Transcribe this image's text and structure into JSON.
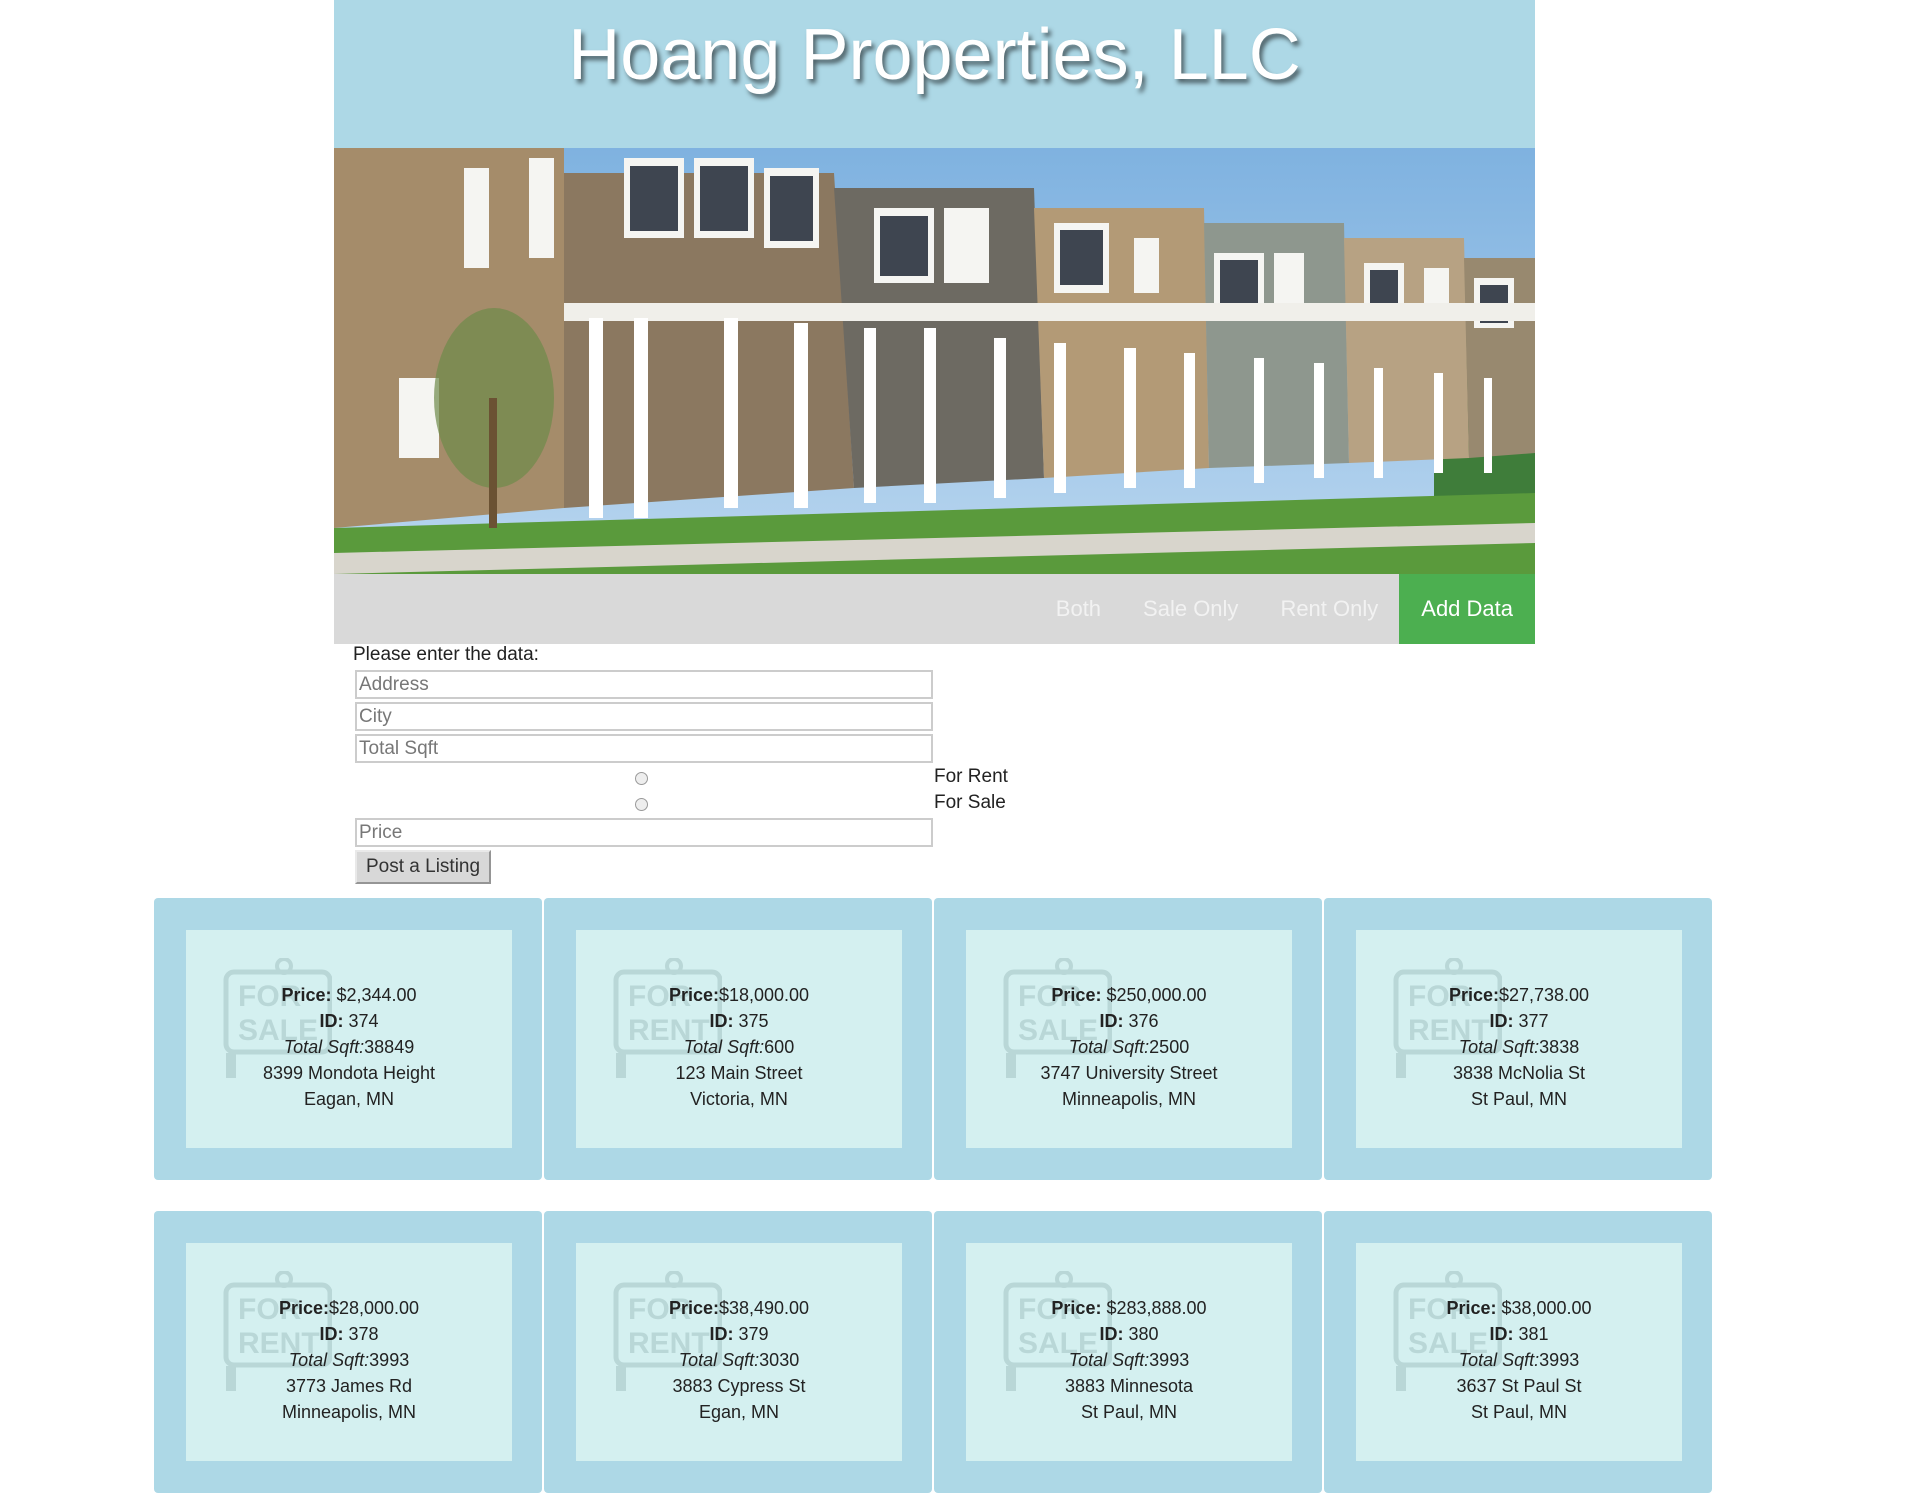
{
  "header": {
    "title": "Hoang Properties, LLC"
  },
  "nav": {
    "items": [
      {
        "label": "Both",
        "active": false
      },
      {
        "label": "Sale Only",
        "active": false
      },
      {
        "label": "Rent Only",
        "active": false
      },
      {
        "label": "Add Data",
        "active": true
      }
    ],
    "active_color": "#4caf50"
  },
  "form": {
    "prompt": "Please enter the data:",
    "address_placeholder": "Address",
    "city_placeholder": "City",
    "sqft_placeholder": "Total Sqft",
    "rent_label": "For Rent",
    "sale_label": "For Sale",
    "price_placeholder": "Price",
    "submit_label": "Post a Listing"
  },
  "labels": {
    "price": "Price:",
    "id": "ID:",
    "sqft": "Total Sqft:"
  },
  "listings": [
    {
      "price": " $2,344.00",
      "id": " 374",
      "sqft": "38849",
      "address": "8399 Mondota Height",
      "city": "Eagan, MN",
      "type": "sale"
    },
    {
      "price": "$18,000.00",
      "id": " 375",
      "sqft": "600",
      "address": "123 Main Street",
      "city": "Victoria, MN",
      "type": "rent"
    },
    {
      "price": " $250,000.00",
      "id": " 376",
      "sqft": "2500",
      "address": "3747 University Street",
      "city": "Minneapolis, MN",
      "type": "sale"
    },
    {
      "price": "$27,738.00",
      "id": " 377",
      "sqft": "3838",
      "address": "3838 McNolia St",
      "city": "St Paul, MN",
      "type": "rent"
    },
    {
      "price": "$28,000.00",
      "id": " 378",
      "sqft": "3993",
      "address": "3773 James Rd",
      "city": "Minneapolis, MN",
      "type": "rent"
    },
    {
      "price": "$38,490.00",
      "id": " 379",
      "sqft": "3030",
      "address": "3883 Cypress St",
      "city": "Egan, MN",
      "type": "rent"
    },
    {
      "price": " $283,888.00",
      "id": " 380",
      "sqft": "3993",
      "address": "3883 Minnesota",
      "city": "St Paul, MN",
      "type": "sale"
    },
    {
      "price": " $38,000.00",
      "id": " 381",
      "sqft": "3993",
      "address": "3637 St Paul St",
      "city": "St Paul, MN",
      "type": "sale"
    }
  ],
  "sign_text": {
    "sale": [
      "FOR",
      "SALE"
    ],
    "rent": [
      "FOR",
      "RENT"
    ]
  }
}
